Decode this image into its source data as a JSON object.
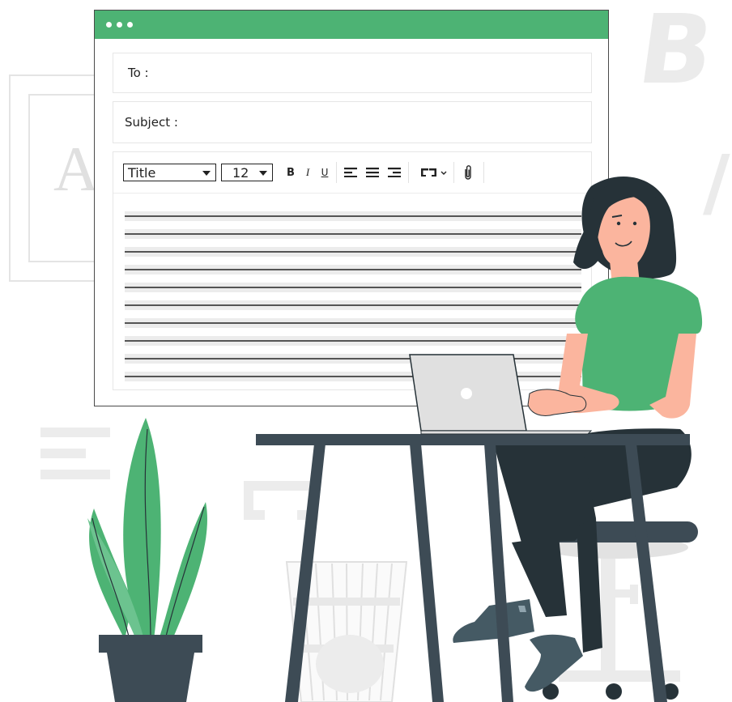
{
  "window": {
    "controls": [
      "dot",
      "dot",
      "dot"
    ],
    "to_label": "To :",
    "subject_label": "Subject :"
  },
  "toolbar": {
    "style_select": "Title",
    "size_select": "12",
    "bold": "B",
    "italic": "I",
    "underline": "U",
    "align_left_icon": "align-left-icon",
    "align_center_icon": "align-center-icon",
    "align_right_icon": "align-right-icon",
    "link_icon": "link-icon",
    "attachment_icon": "paperclip-icon"
  },
  "background": {
    "letter_b": "B",
    "slash": "/",
    "letter_a": "A"
  },
  "colors": {
    "accent": "#4db374",
    "shirt": "#4db374",
    "dark": "#3d4b55",
    "skin": "#fbb59e",
    "hair": "#263238"
  }
}
